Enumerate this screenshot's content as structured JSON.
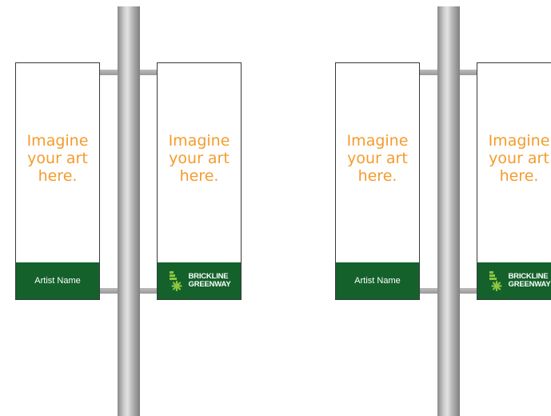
{
  "banner_pairs": [
    {
      "left": {
        "art_text": [
          "Imagine",
          "your art",
          "here."
        ],
        "footer_label": "Artist Name"
      },
      "right": {
        "art_text": [
          "Imagine",
          "your art",
          "here."
        ],
        "logo_line1": "BRICKLINE",
        "logo_line2": "GREENWAY"
      }
    },
    {
      "left": {
        "art_text": [
          "Imagine",
          "your art",
          "here."
        ],
        "footer_label": "Artist Name"
      },
      "right": {
        "art_text": [
          "Imagine",
          "your art",
          "here."
        ],
        "logo_line1": "BRICKLINE",
        "logo_line2": "GREENWAY"
      }
    }
  ],
  "colors": {
    "art_text": "#f59b2d",
    "footer": "#14612c",
    "logo_accent": "#8dc63f"
  }
}
